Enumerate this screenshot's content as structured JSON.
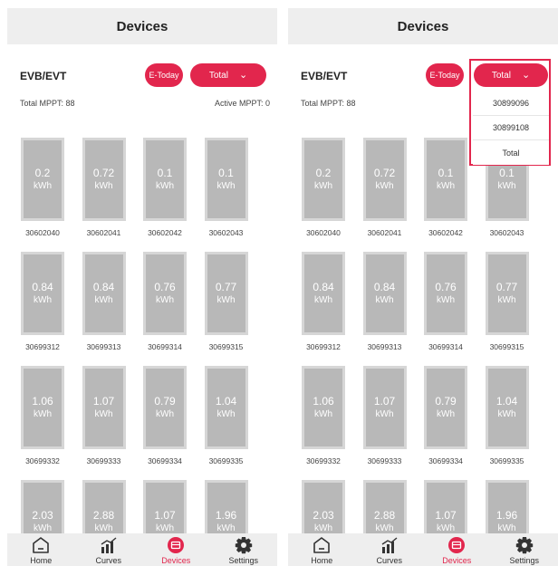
{
  "header": {
    "title": "Devices"
  },
  "controls": {
    "device_type": "EVB/EVT",
    "today_label": "E-Today",
    "total_label": "Total"
  },
  "stats": {
    "total_mppt": "Total MPPT: 88",
    "active_mppt": "Active MPPT: 0"
  },
  "devices": [
    {
      "value": "0.2",
      "unit": "kWh",
      "sn": "30602040"
    },
    {
      "value": "0.72",
      "unit": "kWh",
      "sn": "30602041"
    },
    {
      "value": "0.1",
      "unit": "kWh",
      "sn": "30602042"
    },
    {
      "value": "0.1",
      "unit": "kWh",
      "sn": "30602043"
    },
    {
      "value": "0.84",
      "unit": "kWh",
      "sn": "30699312"
    },
    {
      "value": "0.84",
      "unit": "kWh",
      "sn": "30699313"
    },
    {
      "value": "0.76",
      "unit": "kWh",
      "sn": "30699314"
    },
    {
      "value": "0.77",
      "unit": "kWh",
      "sn": "30699315"
    },
    {
      "value": "1.06",
      "unit": "kWh",
      "sn": "30699332"
    },
    {
      "value": "1.07",
      "unit": "kWh",
      "sn": "30699333"
    },
    {
      "value": "0.79",
      "unit": "kWh",
      "sn": "30699334"
    },
    {
      "value": "1.04",
      "unit": "kWh",
      "sn": "30699335"
    },
    {
      "value": "2.03",
      "unit": "kWh",
      "sn": ""
    },
    {
      "value": "2.88",
      "unit": "kWh",
      "sn": ""
    },
    {
      "value": "1.07",
      "unit": "kWh",
      "sn": ""
    },
    {
      "value": "1.96",
      "unit": "kWh",
      "sn": ""
    }
  ],
  "dropdown": {
    "options": [
      "30899096",
      "30899108",
      "Total"
    ]
  },
  "nav": [
    {
      "label": "Home",
      "icon": "home-icon"
    },
    {
      "label": "Curves",
      "icon": "curves-icon"
    },
    {
      "label": "Devices",
      "icon": "devices-icon",
      "active": true
    },
    {
      "label": "Settings",
      "icon": "settings-icon"
    }
  ],
  "colors": {
    "accent": "#e2264d",
    "tile": "#b8b8b8",
    "header_bg": "#eeeeee"
  }
}
